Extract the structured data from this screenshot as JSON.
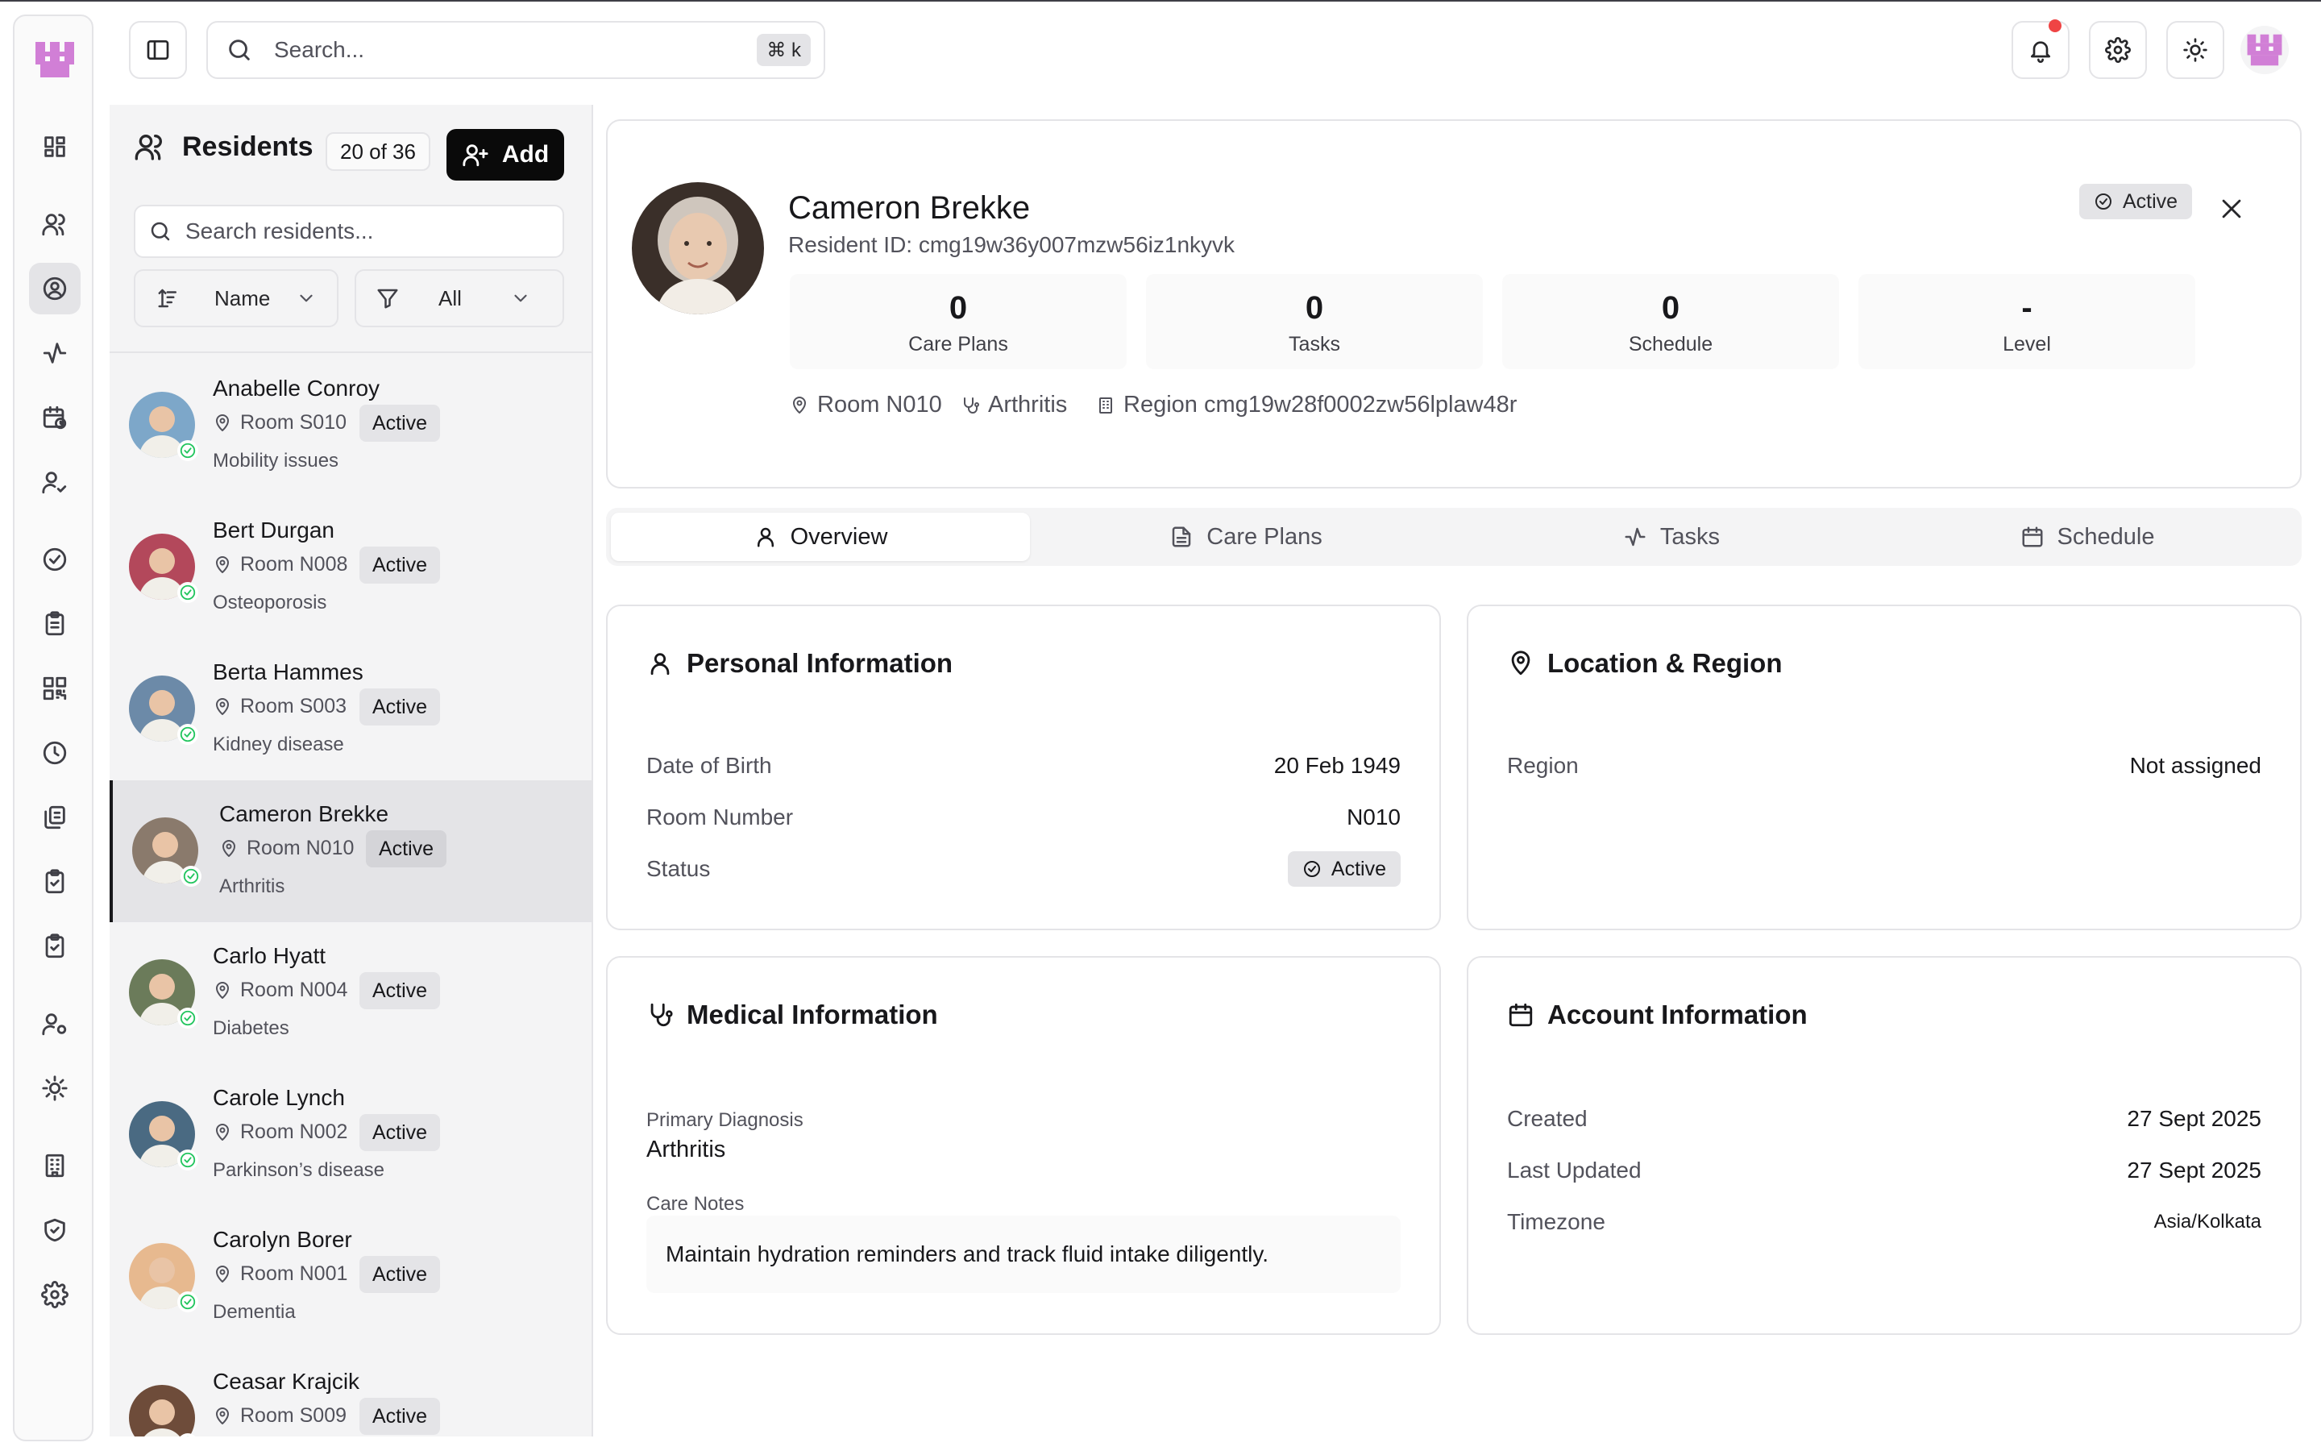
{
  "topbar": {
    "search_placeholder": "Search...",
    "search_shortcut": "⌘ k"
  },
  "residents_panel": {
    "title": "Residents",
    "count": "20 of 36",
    "add_label": "Add",
    "search_placeholder": "Search residents...",
    "sort_label": "Name",
    "filter_label": "All",
    "items": [
      {
        "name": "Anabelle Conroy",
        "room": "Room S010",
        "status": "Active",
        "condition": "Mobility issues",
        "avatar_color": "#7da7c9"
      },
      {
        "name": "Bert Durgan",
        "room": "Room N008",
        "status": "Active",
        "condition": "Osteoporosis",
        "avatar_color": "#b3485b"
      },
      {
        "name": "Berta Hammes",
        "room": "Room S003",
        "status": "Active",
        "condition": "Kidney disease",
        "avatar_color": "#6c8aa8"
      },
      {
        "name": "Cameron Brekke",
        "room": "Room N010",
        "status": "Active",
        "condition": "Arthritis",
        "avatar_color": "#8a7a6c"
      },
      {
        "name": "Carlo Hyatt",
        "room": "Room N004",
        "status": "Active",
        "condition": "Diabetes",
        "avatar_color": "#6b7b5a"
      },
      {
        "name": "Carole Lynch",
        "room": "Room N002",
        "status": "Active",
        "condition": "Parkinson’s disease",
        "avatar_color": "#4a6a82"
      },
      {
        "name": "Carolyn Borer",
        "room": "Room N001",
        "status": "Active",
        "condition": "Dementia",
        "avatar_color": "#e7b98f"
      },
      {
        "name": "Ceasar Krajcik",
        "room": "Room S009",
        "status": "Active",
        "condition": "",
        "avatar_color": "#6e4c3a"
      }
    ]
  },
  "profile": {
    "name": "Cameron Brekke",
    "resident_id": "Resident ID: cmg19w36y007mzw56iz1nkyvk",
    "status": "Active",
    "stats": [
      {
        "value": "0",
        "label": "Care Plans"
      },
      {
        "value": "0",
        "label": "Tasks"
      },
      {
        "value": "0",
        "label": "Schedule"
      },
      {
        "value": "-",
        "label": "Level"
      }
    ],
    "room": "Room N010",
    "condition": "Arthritis",
    "region": "Region cmg19w28f0002zw56lplaw48r"
  },
  "tabs": [
    "Overview",
    "Care Plans",
    "Tasks",
    "Schedule"
  ],
  "personal_info": {
    "title": "Personal Information",
    "dob_label": "Date of Birth",
    "dob_value": "20 Feb 1949",
    "room_label": "Room Number",
    "room_value": "N010",
    "status_label": "Status",
    "status_value": "Active"
  },
  "location_info": {
    "title": "Location & Region",
    "region_label": "Region",
    "region_value": "Not assigned"
  },
  "medical_info": {
    "title": "Medical Information",
    "diagnosis_label": "Primary Diagnosis",
    "diagnosis_value": "Arthritis",
    "notes_label": "Care Notes",
    "notes_value": "Maintain hydration reminders and track fluid intake diligently."
  },
  "account_info": {
    "title": "Account Information",
    "created_label": "Created",
    "created_value": "27 Sept 2025",
    "updated_label": "Last Updated",
    "updated_value": "27 Sept 2025",
    "timezone_label": "Timezone",
    "timezone_value": "Asia/Kolkata"
  },
  "colors": {
    "accent_logo": "#d17fd6",
    "primary_button": "#0a0a0a",
    "success": "#22c55e",
    "notification": "#ef4444"
  }
}
